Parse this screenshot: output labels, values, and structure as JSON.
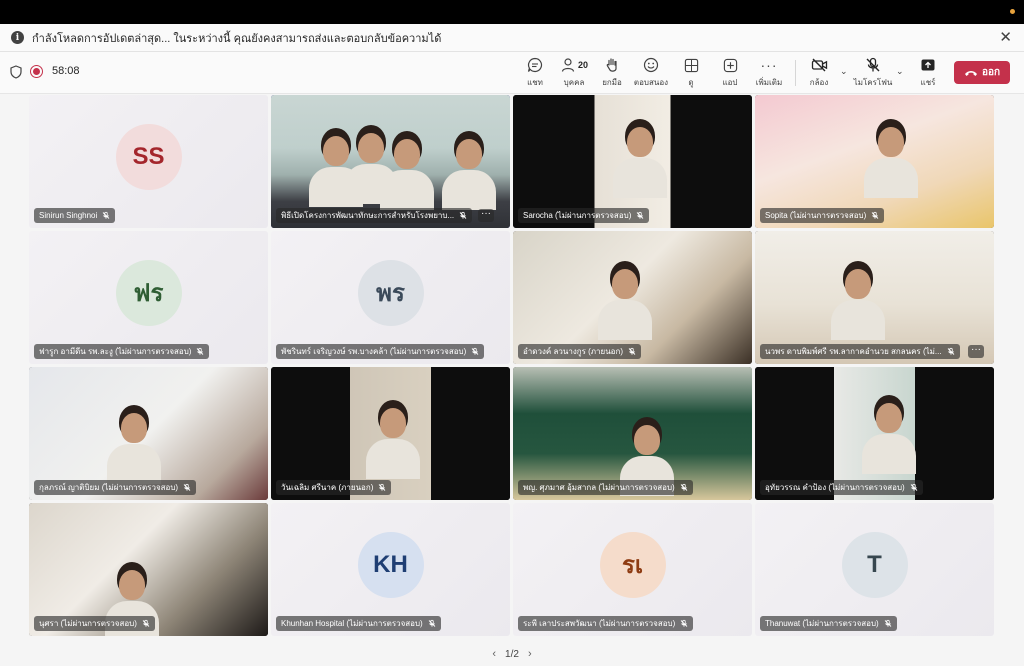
{
  "banner": {
    "message": "กำลังโหลดการอัปเดตล่าสุด... ในระหว่างนี้ คุณยังคงสามารถส่งและตอบกลับข้อความได้"
  },
  "meeting": {
    "timer": "58:08"
  },
  "toolbar": {
    "chat_label": "แชท",
    "people_label": "บุคคล",
    "people_count": "20",
    "raise_label": "ยกมือ",
    "react_label": "ตอบสนอง",
    "view_label": "ดู",
    "apps_label": "แอป",
    "more_label": "เพิ่มเติม",
    "camera_label": "กล้อง",
    "mic_label": "ไมโครโฟน",
    "share_label": "แชร์",
    "leave_label": "ออก"
  },
  "participants": [
    {
      "name": "Sinirun Singhnoi",
      "type": "avatar",
      "initials": "SS",
      "avatar_bg": "#f2dcdc",
      "avatar_fg": "#a4262c"
    },
    {
      "name": "พิธีเปิดโครงการพัฒนาทักษะการสำหรับโรงพยาบ...",
      "type": "video",
      "active": true,
      "more": true
    },
    {
      "name": "Sarocha (ไม่ผ่านการตรวจสอบ)",
      "type": "video"
    },
    {
      "name": "Sopita (ไม่ผ่านการตรวจสอบ)",
      "type": "video"
    },
    {
      "name": "ฟารูก อามีดีน รพ.ละงู (ไม่ผ่านการตรวจสอบ)",
      "type": "avatar",
      "initials": "ฟร",
      "avatar_bg": "#dbe8dc",
      "avatar_fg": "#2f5e34"
    },
    {
      "name": "พัชรินทร์ เจริญวงษ์ รพ.บางคล้า (ไม่ผ่านการตรวจสอบ)",
      "type": "avatar",
      "initials": "พร",
      "avatar_bg": "#dde1e6",
      "avatar_fg": "#3b4a5a"
    },
    {
      "name": "อำดวงค์ ลวนางกูร (ภายนอก)",
      "type": "video"
    },
    {
      "name": "นวพร ดาบพิมพ์ศรี รพ.ลากาคอำนวย สกลนคร (ไม่...",
      "type": "video",
      "more": true
    },
    {
      "name": "กุลภรณ์ ญาติบิยม (ไม่ผ่านการตรวจสอบ)",
      "type": "video"
    },
    {
      "name": "วันเฉลิม ศรีนาค (ภายนอก)",
      "type": "video"
    },
    {
      "name": "พญ. ศุภมาศ อุ้มสากล (ไม่ผ่านการตรวจสอบ)",
      "type": "video"
    },
    {
      "name": "อุทัยวรรณ คำป้อง (ไม่ผ่านการตรวจสอบ)",
      "type": "video"
    },
    {
      "name": "นุศรา (ไม่ผ่านการตรวจสอบ)",
      "type": "video"
    },
    {
      "name": "Khunhan Hospital (ไม่ผ่านการตรวจสอบ)",
      "type": "avatar",
      "initials": "KH",
      "avatar_bg": "#d6e0f0",
      "avatar_fg": "#1f3e73"
    },
    {
      "name": "ระพี เลาประสพวัฒนา (ไม่ผ่านการตรวจสอบ)",
      "type": "avatar",
      "initials": "รเ",
      "avatar_bg": "#f5dccb",
      "avatar_fg": "#8e3b12"
    },
    {
      "name": "Thanuwat (ไม่ผ่านการตรวจสอบ)",
      "type": "avatar",
      "initials": "T",
      "avatar_bg": "#dde3e8",
      "avatar_fg": "#37474f"
    }
  ],
  "pager": {
    "text": "1/2"
  },
  "colors": {
    "accent": "#5b5fc7",
    "leave": "#c4314b"
  }
}
